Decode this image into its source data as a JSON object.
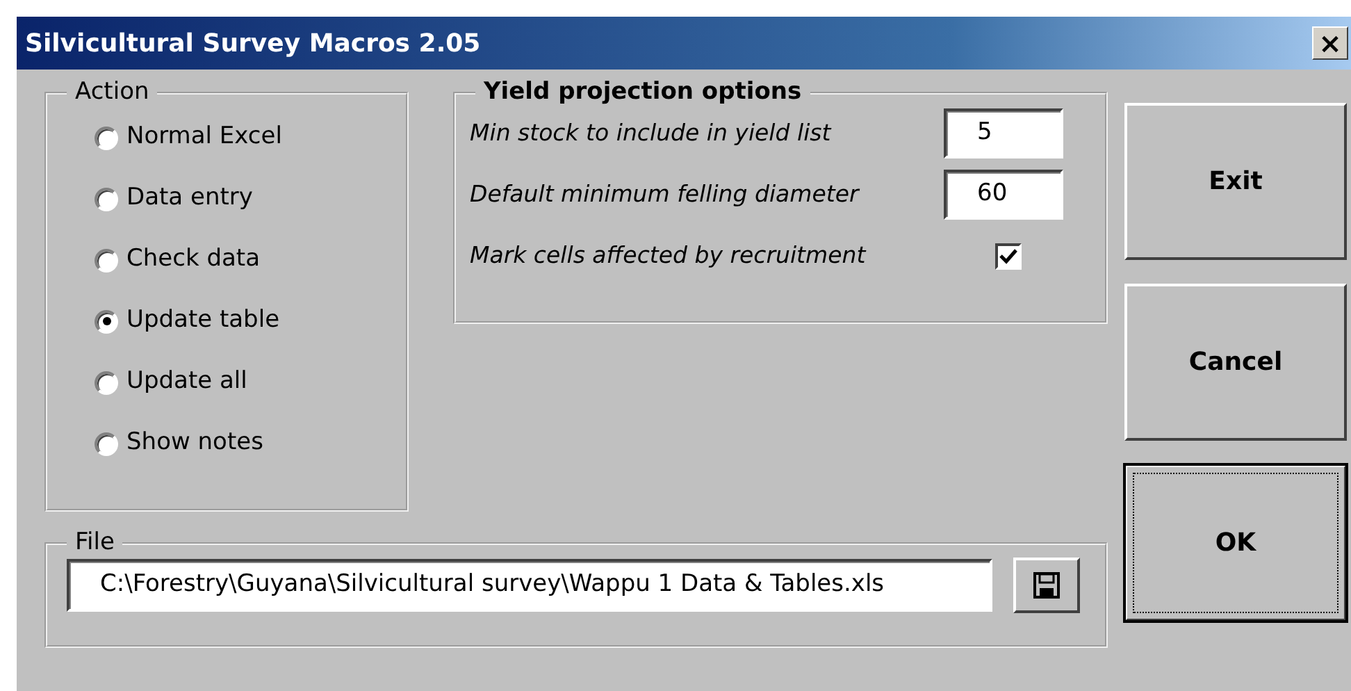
{
  "window": {
    "title": "Silvicultural Survey Macros 2.05",
    "close": "×"
  },
  "action": {
    "legend": "Action",
    "options": [
      {
        "label": "Normal Excel",
        "selected": false
      },
      {
        "label": "Data entry",
        "selected": false
      },
      {
        "label": "Check data",
        "selected": false
      },
      {
        "label": "Update table",
        "selected": true
      },
      {
        "label": "Update all",
        "selected": false
      },
      {
        "label": "Show notes",
        "selected": false
      }
    ]
  },
  "yield_options": {
    "legend": "Yield projection options",
    "rows": [
      {
        "kind": "text",
        "label": "Min stock to include in yield list",
        "value": "5"
      },
      {
        "kind": "text",
        "label": "Default minimum felling diameter",
        "value": "60"
      },
      {
        "kind": "checkbox",
        "label": "Mark cells affected by recruitment",
        "checked": true
      }
    ]
  },
  "file": {
    "legend": "File",
    "path": "C:\\Forestry\\Guyana\\Silvicultural survey\\Wappu 1 Data & Tables.xls"
  },
  "buttons": [
    {
      "label": "Exit",
      "default": false
    },
    {
      "label": "Cancel",
      "default": false
    },
    {
      "label": "OK",
      "default": true
    }
  ]
}
